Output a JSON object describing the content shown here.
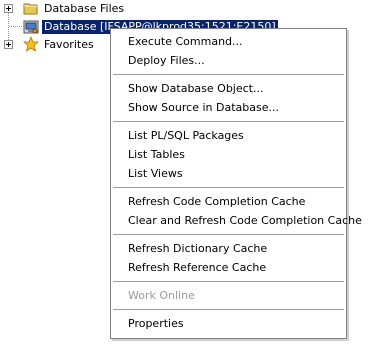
{
  "tree": {
    "items": [
      {
        "label": "Database Files",
        "icon": "folder-icon"
      },
      {
        "label": "Database [IFSAPP@lkprod35:1521:E2150]",
        "icon": "database-icon",
        "selected": true
      },
      {
        "label": "Favorites",
        "icon": "star-icon"
      }
    ]
  },
  "context_menu": {
    "items": [
      {
        "label": "Execute Command..."
      },
      {
        "label": "Deploy Files..."
      },
      {
        "label": "Show Database Object..."
      },
      {
        "label": "Show Source in Database..."
      },
      {
        "label": "List PL/SQL Packages"
      },
      {
        "label": "List Tables"
      },
      {
        "label": "List Views"
      },
      {
        "label": "Refresh Code Completion Cache"
      },
      {
        "label": "Clear and Refresh Code Completion Cache"
      },
      {
        "label": "Refresh Dictionary Cache"
      },
      {
        "label": "Refresh Reference Cache"
      },
      {
        "label": "Work Online",
        "disabled": true
      },
      {
        "label": "Properties"
      }
    ]
  },
  "colors": {
    "selection": "#0a246a",
    "disabled_text": "#9a9a9a"
  }
}
